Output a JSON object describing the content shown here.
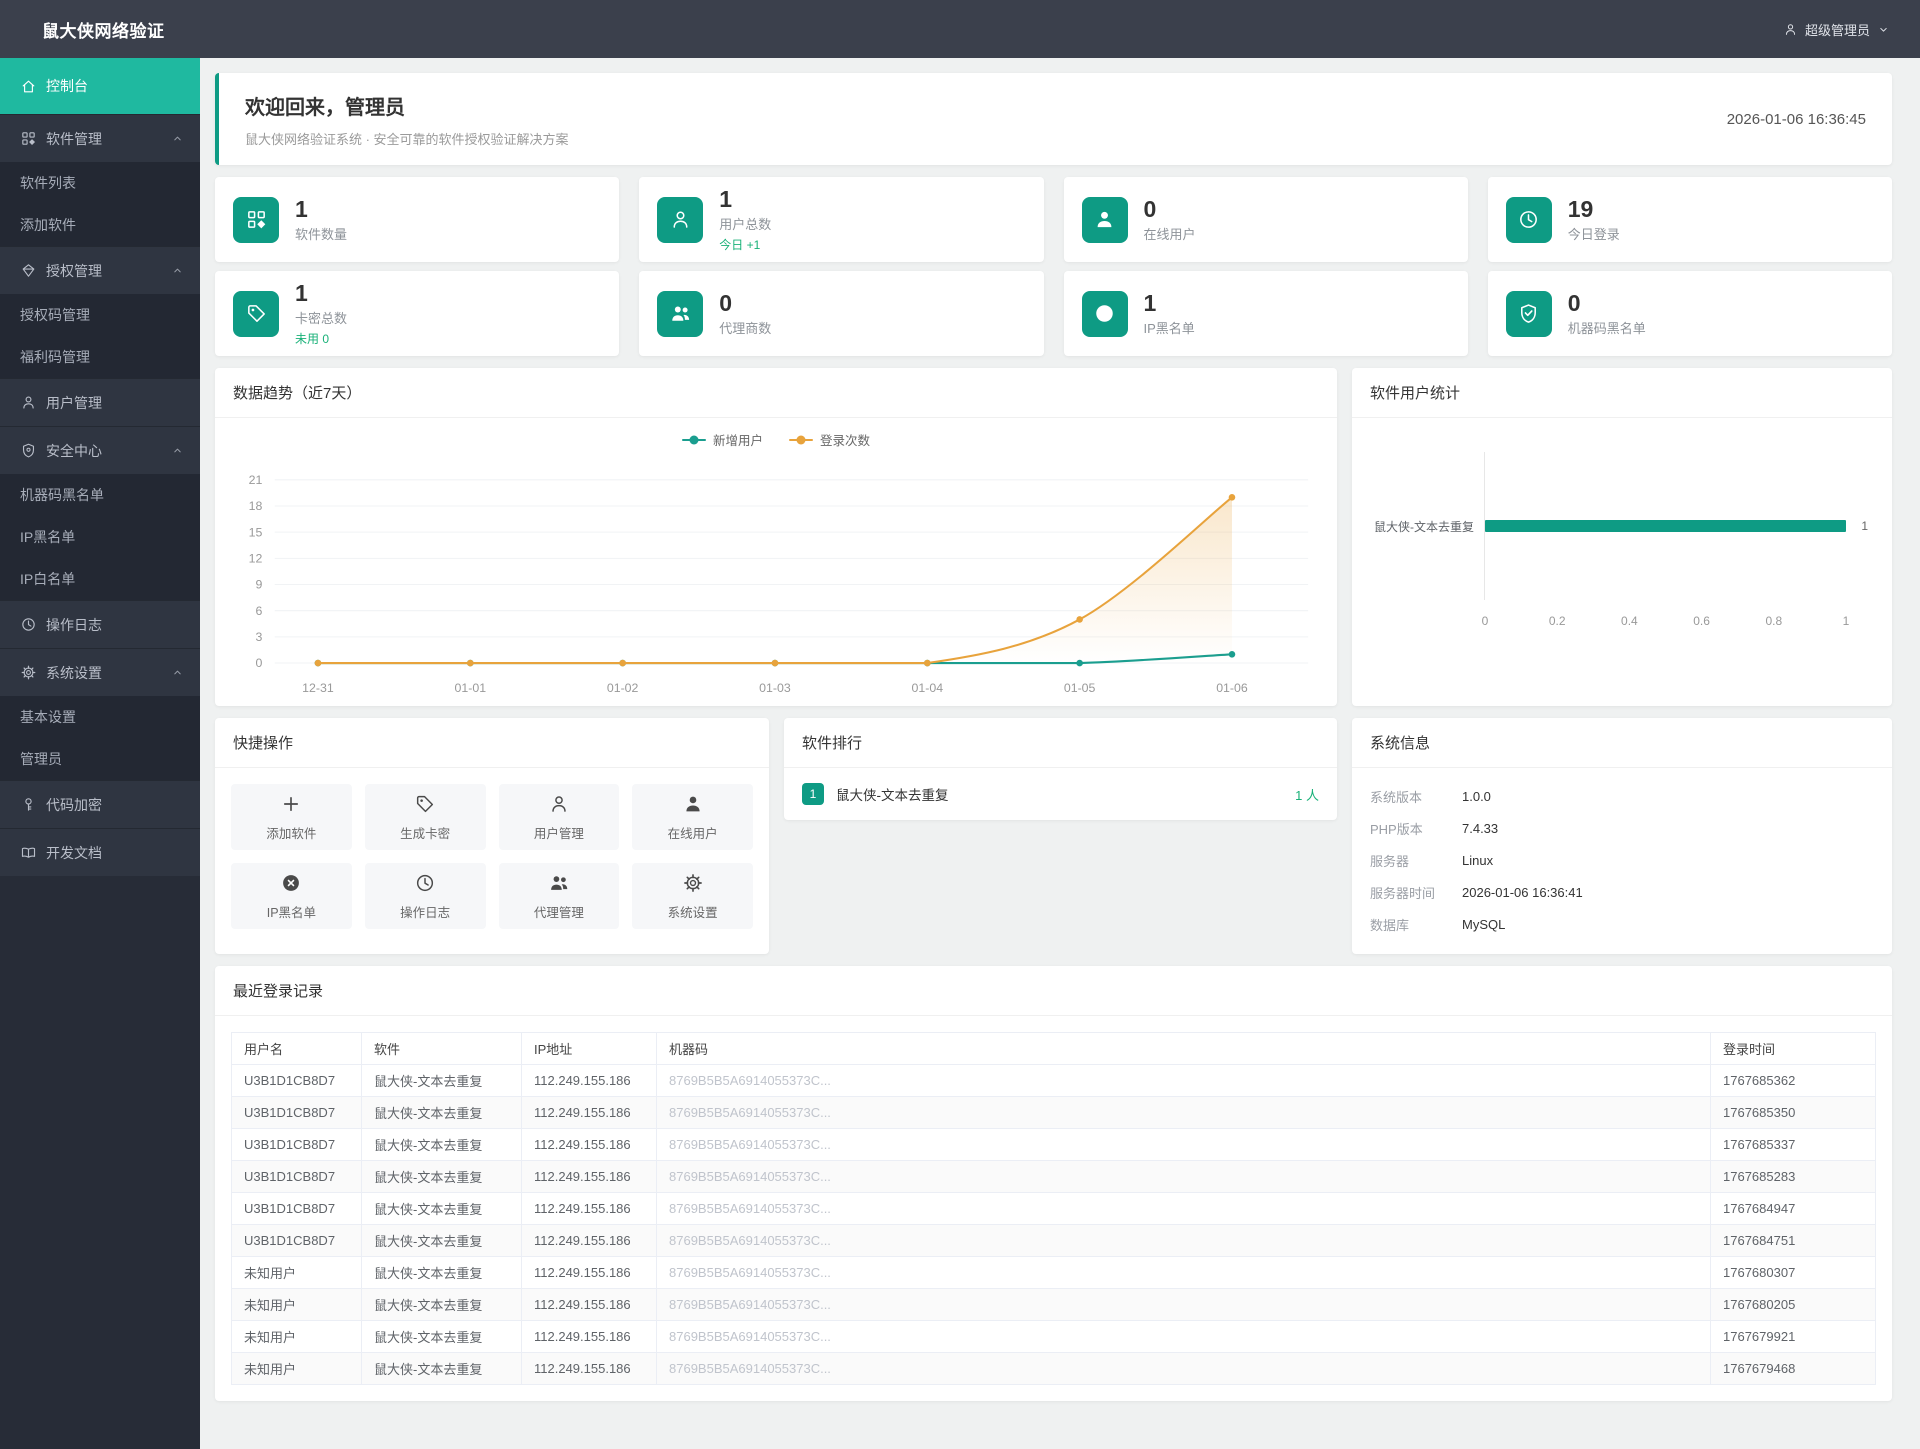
{
  "app": {
    "title": "鼠大侠网络验证",
    "user": "超级管理员"
  },
  "colors": {
    "accent": "#0e9b84",
    "active": "#1fb9a0",
    "green": "#18b178",
    "orange": "#e8a33c",
    "teal_line": "#1a9e8f"
  },
  "sidebar": {
    "items": [
      {
        "key": "console",
        "label": "控制台",
        "type": "active",
        "icon": "home"
      },
      {
        "key": "software-group",
        "label": "软件管理",
        "type": "group",
        "icon": "grid"
      },
      {
        "key": "software-list",
        "label": "软件列表",
        "type": "sub"
      },
      {
        "key": "add-software",
        "label": "添加软件",
        "type": "sub"
      },
      {
        "key": "auth-group",
        "label": "授权管理",
        "type": "group",
        "icon": "diamond"
      },
      {
        "key": "auth-codes",
        "label": "授权码管理",
        "type": "sub"
      },
      {
        "key": "welfare-codes",
        "label": "福利码管理",
        "type": "sub"
      },
      {
        "key": "user-mgmt",
        "label": "用户管理",
        "type": "item",
        "icon": "user"
      },
      {
        "key": "security-group",
        "label": "安全中心",
        "type": "group",
        "icon": "shield"
      },
      {
        "key": "machine-blacklist",
        "label": "机器码黑名单",
        "type": "sub"
      },
      {
        "key": "ip-blacklist",
        "label": "IP黑名单",
        "type": "sub"
      },
      {
        "key": "ip-whitelist",
        "label": "IP白名单",
        "type": "sub"
      },
      {
        "key": "op-logs",
        "label": "操作日志",
        "type": "item",
        "icon": "clock"
      },
      {
        "key": "settings-group",
        "label": "系统设置",
        "type": "group",
        "icon": "gear"
      },
      {
        "key": "basic-settings",
        "label": "基本设置",
        "type": "sub"
      },
      {
        "key": "admins",
        "label": "管理员",
        "type": "sub"
      },
      {
        "key": "code-encrypt",
        "label": "代码加密",
        "type": "item",
        "icon": "key"
      },
      {
        "key": "dev-docs",
        "label": "开发文档",
        "type": "item",
        "icon": "book"
      }
    ]
  },
  "welcome": {
    "title": "欢迎回来，管理员",
    "subtitle": "鼠大侠网络验证系统 · 安全可靠的软件授权验证解决方案",
    "time": "2026-01-06 16:36:45"
  },
  "stats": [
    {
      "key": "software-count",
      "value": "1",
      "label": "软件数量",
      "icon": "grid"
    },
    {
      "key": "user-total",
      "value": "1",
      "label": "用户总数",
      "sub": "今日 +1",
      "icon": "user"
    },
    {
      "key": "online-users",
      "value": "0",
      "label": "在线用户",
      "icon": "user-filled"
    },
    {
      "key": "today-logins",
      "value": "19",
      "label": "今日登录",
      "icon": "clock"
    },
    {
      "key": "card-total",
      "value": "1",
      "label": "卡密总数",
      "sub": "未用 0",
      "icon": "tag"
    },
    {
      "key": "agent-count",
      "value": "0",
      "label": "代理商数",
      "icon": "users"
    },
    {
      "key": "ip-blacklist",
      "value": "1",
      "label": "IP黑名单",
      "icon": "circle-x"
    },
    {
      "key": "machine-blacklist",
      "value": "0",
      "label": "机器码黑名单",
      "icon": "shield-check"
    }
  ],
  "chart_data": [
    {
      "type": "line",
      "title": "数据趋势（近7天）",
      "x": [
        "12-31",
        "01-01",
        "01-02",
        "01-03",
        "01-04",
        "01-05",
        "01-06"
      ],
      "series": [
        {
          "name": "新增用户",
          "color": "#1a9e8f",
          "values": [
            0,
            0,
            0,
            0,
            0,
            0,
            1
          ],
          "area": false
        },
        {
          "name": "登录次数",
          "color": "#e8a33c",
          "values": [
            0,
            0,
            0,
            0,
            0,
            5,
            19
          ],
          "area": true
        }
      ],
      "ylim": [
        0,
        21
      ],
      "yticks": [
        0,
        3,
        6,
        9,
        12,
        15,
        18,
        21
      ],
      "legend_position": "top",
      "grid": true
    },
    {
      "type": "bar",
      "orientation": "horizontal",
      "title": "软件用户统计",
      "categories": [
        "鼠大侠-文本去重复"
      ],
      "values": [
        1
      ],
      "xlim": [
        0,
        1
      ],
      "xticks": [
        0,
        0.2,
        0.4,
        0.6,
        0.8,
        1
      ],
      "color": "#0e9b84"
    }
  ],
  "quick": {
    "title": "快捷操作",
    "items": [
      {
        "key": "add-software",
        "label": "添加软件",
        "icon": "plus"
      },
      {
        "key": "gen-card",
        "label": "生成卡密",
        "icon": "tag"
      },
      {
        "key": "user-mgmt",
        "label": "用户管理",
        "icon": "user"
      },
      {
        "key": "online-users",
        "label": "在线用户",
        "icon": "user-filled"
      },
      {
        "key": "ip-blacklist",
        "label": "IP黑名单",
        "icon": "circle-x"
      },
      {
        "key": "op-logs",
        "label": "操作日志",
        "icon": "clock"
      },
      {
        "key": "agent-mgmt",
        "label": "代理管理",
        "icon": "users"
      },
      {
        "key": "sys-settings",
        "label": "系统设置",
        "icon": "gear"
      }
    ]
  },
  "ranking": {
    "title": "软件排行",
    "items": [
      {
        "rank": "1",
        "name": "鼠大侠-文本去重复",
        "count": "1 人"
      }
    ]
  },
  "system_info": {
    "title": "系统信息",
    "rows": [
      [
        "系统版本",
        "1.0.0"
      ],
      [
        "PHP版本",
        "7.4.33"
      ],
      [
        "服务器",
        "Linux"
      ],
      [
        "服务器时间",
        "2026-01-06 16:36:41"
      ],
      [
        "数据库",
        "MySQL"
      ]
    ]
  },
  "logins": {
    "title": "最近登录记录",
    "columns": [
      "用户名",
      "软件",
      "IP地址",
      "机器码",
      "登录时间"
    ],
    "rows": [
      [
        "U3B1D1CB8D7",
        "鼠大侠-文本去重复",
        "112.249.155.186",
        "8769B5B5A6914055373C...",
        "1767685362"
      ],
      [
        "U3B1D1CB8D7",
        "鼠大侠-文本去重复",
        "112.249.155.186",
        "8769B5B5A6914055373C...",
        "1767685350"
      ],
      [
        "U3B1D1CB8D7",
        "鼠大侠-文本去重复",
        "112.249.155.186",
        "8769B5B5A6914055373C...",
        "1767685337"
      ],
      [
        "U3B1D1CB8D7",
        "鼠大侠-文本去重复",
        "112.249.155.186",
        "8769B5B5A6914055373C...",
        "1767685283"
      ],
      [
        "U3B1D1CB8D7",
        "鼠大侠-文本去重复",
        "112.249.155.186",
        "8769B5B5A6914055373C...",
        "1767684947"
      ],
      [
        "U3B1D1CB8D7",
        "鼠大侠-文本去重复",
        "112.249.155.186",
        "8769B5B5A6914055373C...",
        "1767684751"
      ],
      [
        "未知用户",
        "鼠大侠-文本去重复",
        "112.249.155.186",
        "8769B5B5A6914055373C...",
        "1767680307"
      ],
      [
        "未知用户",
        "鼠大侠-文本去重复",
        "112.249.155.186",
        "8769B5B5A6914055373C...",
        "1767680205"
      ],
      [
        "未知用户",
        "鼠大侠-文本去重复",
        "112.249.155.186",
        "8769B5B5A6914055373C...",
        "1767679921"
      ],
      [
        "未知用户",
        "鼠大侠-文本去重复",
        "112.249.155.186",
        "8769B5B5A6914055373C...",
        "1767679468"
      ]
    ]
  }
}
